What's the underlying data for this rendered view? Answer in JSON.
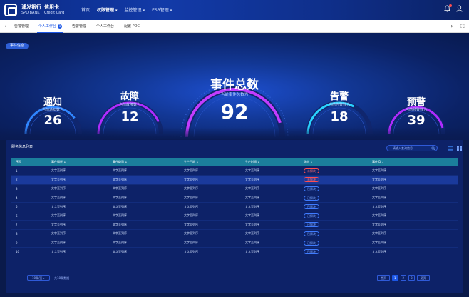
{
  "header": {
    "brand_cn": "浦发银行",
    "brand_en": "SPD BANK",
    "card_cn": "信用卡",
    "card_en": "Credit Card",
    "nav": [
      "首页",
      "权限管理",
      "监控管理",
      "ESB管理"
    ]
  },
  "tabs": [
    "告警管理",
    "个人工作台",
    "告警管理",
    "个人工作台",
    "配置 PDC"
  ],
  "tab_badge": "1",
  "hero": {
    "pill": "事件信息",
    "gauges": [
      {
        "title": "通知",
        "sub": "当前通知数为",
        "value": "26",
        "color": "#2f86ff"
      },
      {
        "title": "故障",
        "sub": "当前故障数为",
        "value": "12",
        "color": "#b02cff"
      },
      {
        "title": "事件总数",
        "sub": "当前事件总数为",
        "value": "92",
        "color": "#c33cff"
      },
      {
        "title": "告警",
        "sub": "当前告警数为",
        "value": "18",
        "color": "#29d3ff"
      },
      {
        "title": "预警",
        "sub": "当前预警数为",
        "value": "39",
        "color": "#b02cff"
      }
    ]
  },
  "panel": {
    "title": "服务信息列表",
    "search_placeholder": "请输入查询信息",
    "columns": [
      "序号",
      "事件描述 ↕",
      "事件级别 ↕",
      "生产日期 ↕",
      "生产时间 ↕",
      "状态 ↕",
      "事件ID ↕"
    ],
    "rows": [
      [
        "1",
        "文字至列序",
        "文字至列序",
        "文字至列序",
        "文字至列序",
        "未解决",
        "文字至列序"
      ],
      [
        "2",
        "文字至列序",
        "文字至列序",
        "文字至列序",
        "文字至列序",
        "未解决",
        "文字至列序"
      ],
      [
        "3",
        "文字至列序",
        "文字至列序",
        "文字至列序",
        "文字至列序",
        "已解决",
        "文字至列序"
      ],
      [
        "4",
        "文字至列序",
        "文字至列序",
        "文字至列序",
        "文字至列序",
        "已解决",
        "文字至列序"
      ],
      [
        "5",
        "文字至列序",
        "文字至列序",
        "文字至列序",
        "文字至列序",
        "已解决",
        "文字至列序"
      ],
      [
        "6",
        "文字至列序",
        "文字至列序",
        "文字至列序",
        "文字至列序",
        "已解决",
        "文字至列序"
      ],
      [
        "7",
        "文字至列序",
        "文字至列序",
        "文字至列序",
        "文字至列序",
        "已解决",
        "文字至列序"
      ],
      [
        "8",
        "文字至列序",
        "文字至列序",
        "文字至列序",
        "文字至列序",
        "已解决",
        "文字至列序"
      ],
      [
        "9",
        "文字至列序",
        "文字至列序",
        "文字至列序",
        "文字至列序",
        "已解决",
        "文字至列序"
      ],
      [
        "10",
        "文字至列序",
        "文字至列序",
        "文字至列序",
        "文字至列序",
        "已解决",
        "文字至列序"
      ]
    ],
    "status_colors": {
      "未解决": "red",
      "已解决": "blue"
    },
    "page_size": "10条/页",
    "total": "共18条数据",
    "pages": [
      "首页",
      "1",
      "2",
      "3",
      "尾页"
    ],
    "current_page": "1"
  }
}
